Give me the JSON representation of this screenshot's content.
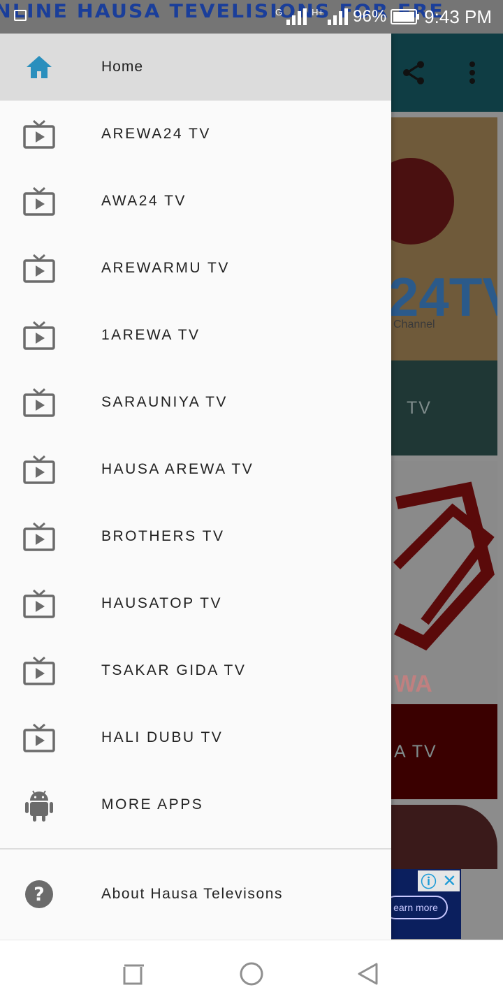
{
  "status_bar": {
    "marquee": "NLINE HAUSA TEVELISIONS FOR FRE",
    "network_1": "G",
    "network_2": "H+",
    "battery": "96%",
    "time": "9:43 PM"
  },
  "drawer": {
    "home": {
      "label": "Home",
      "icon": "home-icon"
    },
    "items": [
      {
        "label": "AREWA24 TV",
        "icon": "tv-play-icon"
      },
      {
        "label": "AWA24 TV",
        "icon": "tv-play-icon"
      },
      {
        "label": "AREWARMU TV",
        "icon": "tv-play-icon"
      },
      {
        "label": "1AREWA TV",
        "icon": "tv-play-icon"
      },
      {
        "label": "SARAUNIYA TV",
        "icon": "tv-play-icon"
      },
      {
        "label": "HAUSA AREWA TV",
        "icon": "tv-play-icon"
      },
      {
        "label": "BROTHERS TV",
        "icon": "tv-play-icon"
      },
      {
        "label": "HAUSATOP TV",
        "icon": "tv-play-icon"
      },
      {
        "label": "TSAKAR GIDA TV",
        "icon": "tv-play-icon"
      },
      {
        "label": "HALI DUBU TV",
        "icon": "tv-play-icon"
      }
    ],
    "more_apps": {
      "label": "MORE APPS",
      "icon": "android-icon"
    },
    "about": {
      "label": "About Hausa Televisons",
      "icon": "help-icon"
    }
  },
  "background": {
    "logo_1_text": "24TV",
    "logo_1_sub": "Channel",
    "card_1_label": "TV",
    "logo_2_text": "WA",
    "card_2_label": "A TV",
    "ad_button": "earn more"
  },
  "colors": {
    "accent": "#2a8fbd",
    "icon_gray": "#6b6b6b",
    "toolbar": "#0f3d44"
  }
}
